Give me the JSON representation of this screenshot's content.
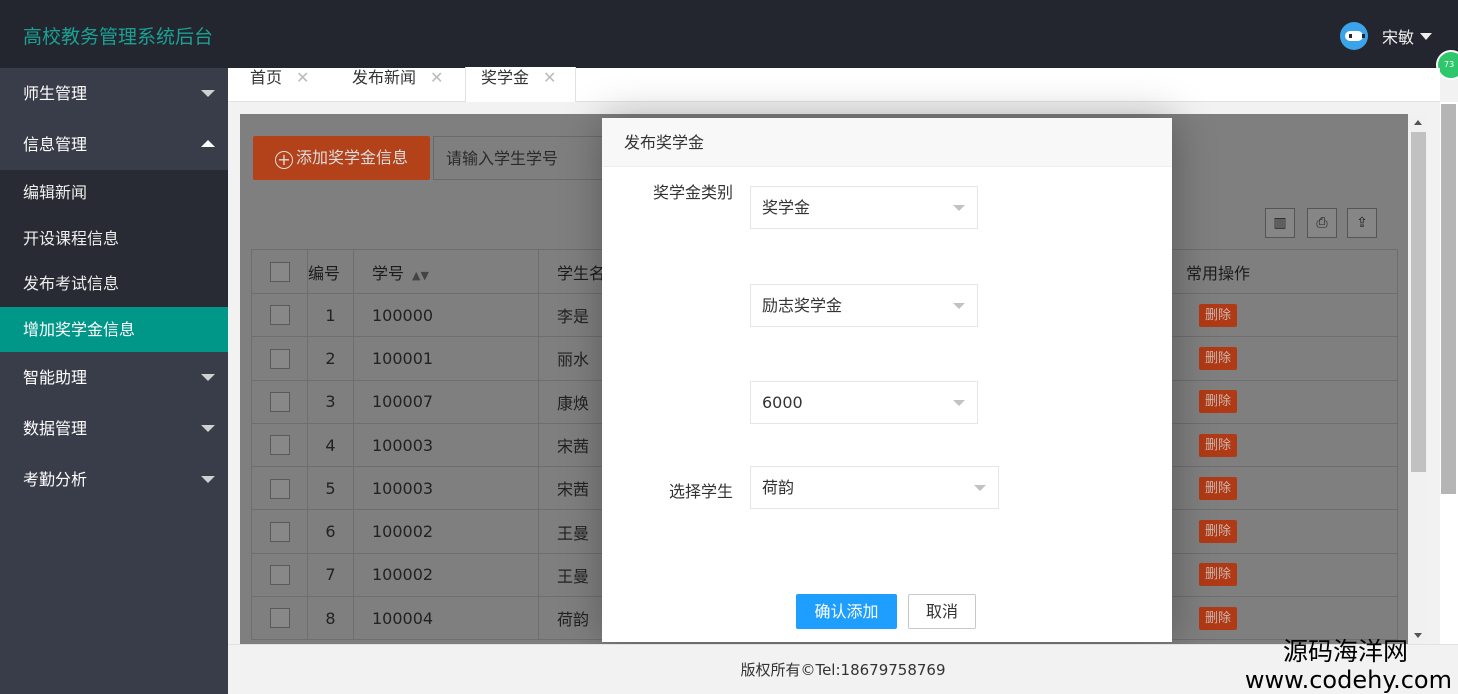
{
  "header": {
    "title": "高校教务管理系统后台",
    "user_name": "宋敏",
    "badge_text": "73"
  },
  "sidebar": {
    "items": [
      {
        "label": "师生管理"
      },
      {
        "label": "信息管理"
      },
      {
        "label": "智能助理"
      },
      {
        "label": "数据管理"
      },
      {
        "label": "考勤分析"
      }
    ],
    "sub_items": [
      {
        "label": "编辑新闻"
      },
      {
        "label": "开设课程信息"
      },
      {
        "label": "发布考试信息"
      },
      {
        "label": "增加奖学金信息"
      }
    ]
  },
  "tabs": [
    {
      "label": "首页",
      "close": "✕"
    },
    {
      "label": "发布新闻",
      "close": "✕"
    },
    {
      "label": "奖学金",
      "close": "✕"
    }
  ],
  "content": {
    "add_button": "添加奖学金信息",
    "search_placeholder": "请输入学生学号",
    "columns": {
      "id": "编号",
      "student_no": "学号",
      "student_name": "学生名",
      "actions": "常用操作"
    },
    "delete_label": "删除",
    "rows": [
      {
        "id": "1",
        "no": "100000",
        "name": "李是"
      },
      {
        "id": "2",
        "no": "100001",
        "name": "丽水"
      },
      {
        "id": "3",
        "no": "100007",
        "name": "康焕"
      },
      {
        "id": "4",
        "no": "100003",
        "name": "宋茜"
      },
      {
        "id": "5",
        "no": "100003",
        "name": "宋茜"
      },
      {
        "id": "6",
        "no": "100002",
        "name": "王曼"
      },
      {
        "id": "7",
        "no": "100002",
        "name": "王曼"
      },
      {
        "id": "8",
        "no": "100004",
        "name": "荷韵"
      }
    ]
  },
  "modal": {
    "title": "发布奖学金",
    "type_label": "奖学金类别",
    "type_value": "奖学金",
    "name_value": "励志奖学金",
    "amount_value": "6000",
    "student_label": "选择学生",
    "student_value": "荷韵",
    "confirm": "确认添加",
    "cancel": "取消"
  },
  "footer": {
    "copyright": "版权所有©Tel:18679758769"
  },
  "watermark": {
    "line1": "源码海洋网",
    "line2": "www.codehy.com"
  }
}
